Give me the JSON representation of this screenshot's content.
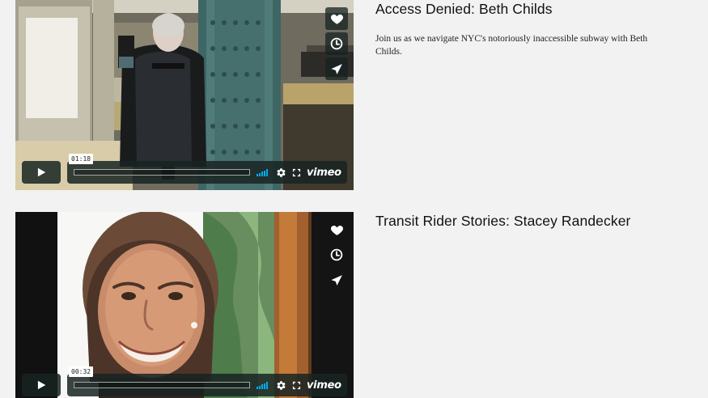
{
  "videos": [
    {
      "title": "Access Denied: Beth Childs",
      "description": "Join us as we navigate NYC's notoriously inaccessible subway with Beth Childs.",
      "time_label": "01:18",
      "progress_percent": 0,
      "logo": "vimeo",
      "action_icons": [
        "heart-icon",
        "clock-icon",
        "send-icon"
      ]
    },
    {
      "title": "Transit Rider Stories: Stacey Randecker",
      "description": "",
      "time_label": "00:32",
      "progress_percent": 0,
      "logo": "vimeo",
      "action_icons": [
        "heart-icon",
        "clock-icon",
        "send-icon"
      ]
    }
  ],
  "colors": {
    "page_background": "#f2f2f2",
    "control_background": "#172322",
    "vimeo_blue": "#00adef",
    "title_text": "#111111"
  },
  "icons": {
    "play": "play-icon",
    "settings": "gear-icon",
    "fullscreen": "fullscreen-icon",
    "volume": "volume-meter"
  }
}
